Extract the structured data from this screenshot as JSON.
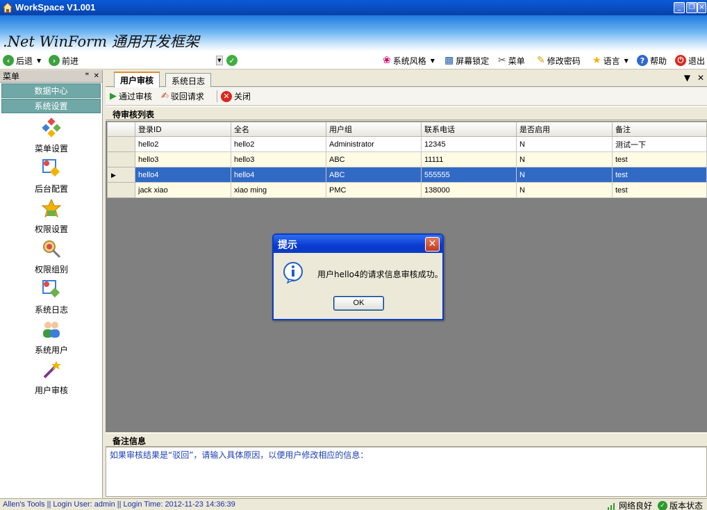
{
  "window": {
    "title": "WorkSpace  V1.001",
    "banner_title": ".Net WinForm 通用开发框架"
  },
  "toolbar": {
    "back": "后退",
    "forward": "前进",
    "theme": "系统风格",
    "lock": "屏幕锁定",
    "menu": "菜单",
    "change_password": "修改密码",
    "language": "语言",
    "help": "帮助",
    "exit": "退出"
  },
  "sidebar": {
    "header": "菜单",
    "pin": "ᵖ x",
    "groups": [
      "数据中心",
      "系统设置"
    ],
    "items": [
      {
        "label": "菜单设置",
        "icon": "menu-settings-icon"
      },
      {
        "label": "后台配置",
        "icon": "backend-config-icon"
      },
      {
        "label": "权限设置",
        "icon": "permission-settings-icon"
      },
      {
        "label": "权限组别",
        "icon": "permission-group-icon"
      },
      {
        "label": "系统日志",
        "icon": "system-log-icon"
      },
      {
        "label": "系统用户",
        "icon": "system-users-icon"
      },
      {
        "label": "用户审核",
        "icon": "user-audit-icon"
      }
    ]
  },
  "tabs": [
    {
      "label": "用户审核",
      "active": true
    },
    {
      "label": "系统日志",
      "active": false
    }
  ],
  "actions": {
    "approve": "通过审核",
    "reject": "驳回请求",
    "close": "关闭"
  },
  "pending_list": {
    "title": "待审核列表",
    "columns": [
      "登录ID",
      "全名",
      "用户组",
      "联系电话",
      "是否启用",
      "备注"
    ],
    "rows": [
      [
        "hello2",
        "hello2",
        "Administrator",
        "12345",
        "N",
        "测试一下"
      ],
      [
        "hello3",
        "hello3",
        "ABC",
        "11111",
        "N",
        "test"
      ],
      [
        "hello4",
        "hello4",
        "ABC",
        "555555",
        "N",
        "test"
      ],
      [
        "jack xiao",
        "xiao ming",
        "PMC",
        "138000",
        "N",
        "test"
      ]
    ],
    "selected_row": 2
  },
  "remarks": {
    "title": "备注信息",
    "hint": "如果审核结果是“驳回”，请输入具体原因，以便用户修改相应的信息："
  },
  "status": {
    "left": "Allen's Tools  ||  Login User: admin  ||  Login Time: 2012-11-23 14:36:39",
    "network": "网络良好",
    "version": "版本状态"
  },
  "dialog": {
    "title": "提示",
    "message": "用户hello4的请求信息审核成功。",
    "ok": "OK"
  },
  "colors": {
    "title_bar": "#0a5ad8",
    "selection": "#316ac5",
    "sidebar_group": "#6fa8a6",
    "alt_row": "#fffbe5"
  }
}
